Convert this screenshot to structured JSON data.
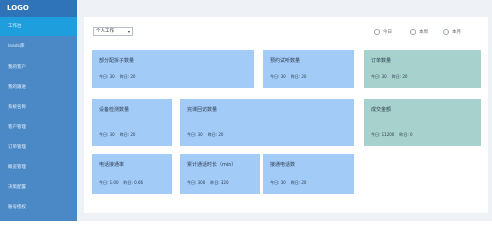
{
  "logo": "LOGO",
  "sidebar": {
    "items": [
      {
        "label": "工作台"
      },
      {
        "label": "leads库"
      },
      {
        "label": "我的客户"
      },
      {
        "label": "我的跟进"
      },
      {
        "label": "系统名称"
      },
      {
        "label": "客户管理"
      },
      {
        "label": "订单管理"
      },
      {
        "label": "概览管理"
      },
      {
        "label": "决策配置"
      },
      {
        "label": "账号授权"
      }
    ]
  },
  "toolbar": {
    "scope_select": "个人工作",
    "period_options": [
      {
        "label": "今日"
      },
      {
        "label": "本周"
      },
      {
        "label": "本月"
      }
    ]
  },
  "cards": [
    {
      "title": "部分配拆子数量",
      "stat1": "今日: 30",
      "stat2": "昨日: 20"
    },
    {
      "title": "预约试听数量",
      "stat1": "今日: 30",
      "stat2": "昨日: 20"
    },
    {
      "title": "订单数量",
      "stat1": "今日: 30",
      "stat2": "昨日: 20"
    },
    {
      "title": "设备检测数量",
      "stat1": "今日: 30",
      "stat2": "昨日: 20"
    },
    {
      "title": "完课回访数量",
      "stat1": "今日: 30",
      "stat2": "昨日: 20"
    },
    {
      "title": "成交金额",
      "stat1": "今日: 11200",
      "stat2": "昨日: 0"
    },
    {
      "title": "电话接通率",
      "stat1": "今日: 1.00",
      "stat2": "昨日: 0.66"
    },
    {
      "title": "累计通话时长（min）",
      "stat1": "今日: 300",
      "stat2": "昨日: 320"
    },
    {
      "title": "接通电话数",
      "stat1": "今日: 30",
      "stat2": "昨日: 20"
    }
  ],
  "colors": {
    "sidebar": "#4a88c6",
    "sidebar_active": "#1f9ede",
    "card_blue": "#a2cbf8",
    "card_teal": "#a7d1cc"
  }
}
